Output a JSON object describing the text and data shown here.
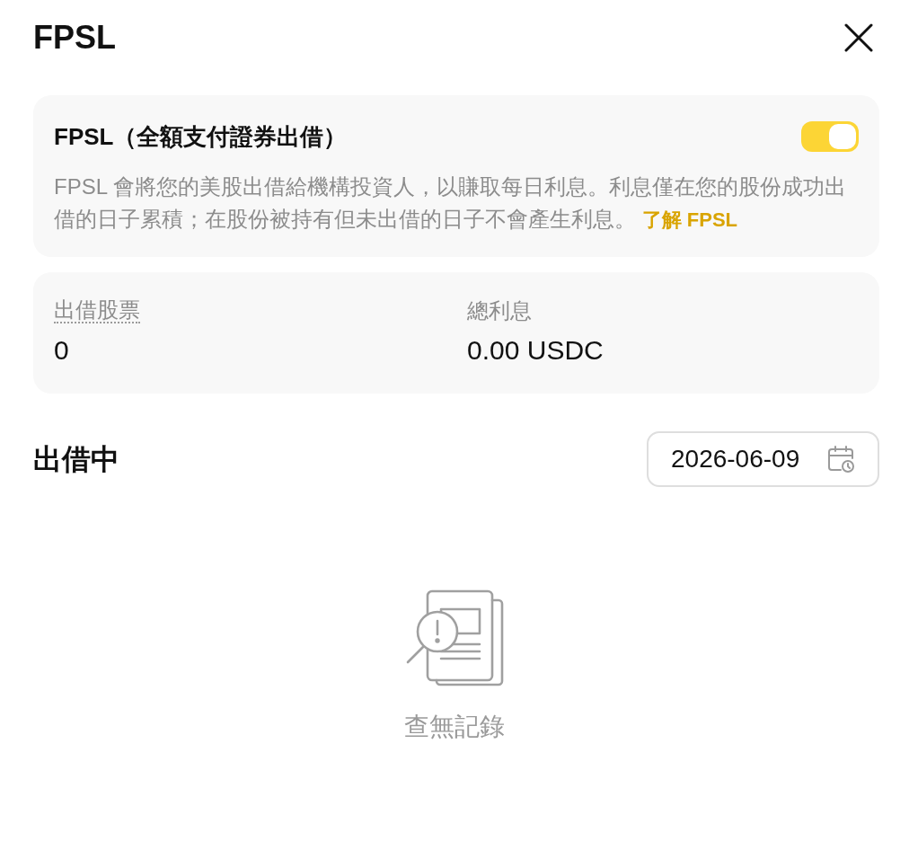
{
  "header": {
    "title": "FPSL"
  },
  "feature_card": {
    "title": "FPSL（全額支付證券出借）",
    "toggle": {
      "on": true
    },
    "description": "FPSL 會將您的美股出借給機構投資人，以賺取每日利息。利息僅在您的股份成功出借的日子累積；在股份被持有但未出借的日子不會產生利息。",
    "link": "了解 FPSL"
  },
  "stats": [
    {
      "label": "出借股票",
      "value": "0",
      "dotted_underline": true
    },
    {
      "label": "總利息",
      "value": "0.00 USDC",
      "dotted_underline": false
    }
  ],
  "lending": {
    "title": "出借中",
    "date_picker": {
      "value": "2026-06-09"
    }
  },
  "empty_state": {
    "message": "查無記錄"
  }
}
